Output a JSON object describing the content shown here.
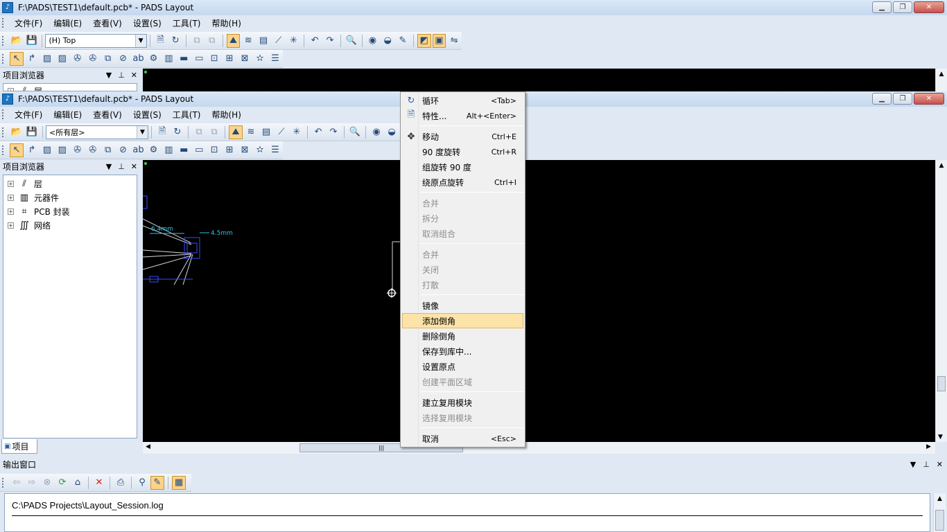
{
  "back_window": {
    "title": "F:\\PADS\\TEST1\\default.pcb* - PADS Layout",
    "layer_select": "(H) Top"
  },
  "front_window": {
    "title": "F:\\PADS\\TEST1\\default.pcb* - PADS Layout",
    "layer_select": "<所有层>"
  },
  "menus": [
    "文件(F)",
    "编辑(E)",
    "查看(V)",
    "设置(S)",
    "工具(T)",
    "帮助(H)"
  ],
  "project_browser": {
    "title": "项目浏览器",
    "tab_label": "项目",
    "back_partial_item": "层",
    "items": [
      {
        "label": "层",
        "icon": "layers-icon"
      },
      {
        "label": "元器件",
        "icon": "component-icon"
      },
      {
        "label": "PCB 封装",
        "icon": "decal-icon"
      },
      {
        "label": "网络",
        "icon": "net-icon"
      }
    ]
  },
  "dimensions": {
    "d1": "6.4mm",
    "d2": "4.5mm"
  },
  "context_menu": {
    "items": [
      {
        "label": "循环",
        "key": "<Tab>",
        "icon": "cycle-icon",
        "enabled": true
      },
      {
        "label": "特性...",
        "key": "Alt+<Enter>",
        "icon": "properties-icon",
        "enabled": true
      },
      {
        "label": "移动",
        "key": "Ctrl+E",
        "icon": "move-icon",
        "enabled": true
      },
      {
        "label": "90 度旋转",
        "key": "Ctrl+R",
        "enabled": true
      },
      {
        "label": "组旋转 90 度",
        "key": "",
        "enabled": true
      },
      {
        "label": "绕原点旋转",
        "key": "Ctrl+I",
        "enabled": true
      },
      {
        "label": "合并",
        "key": "",
        "enabled": false
      },
      {
        "label": "拆分",
        "key": "",
        "enabled": false
      },
      {
        "label": "取消组合",
        "key": "",
        "enabled": false
      },
      {
        "label": "合并",
        "key": "",
        "enabled": false
      },
      {
        "label": "关闭",
        "key": "",
        "enabled": false
      },
      {
        "label": "打散",
        "key": "",
        "enabled": false
      },
      {
        "label": "镜像",
        "key": "",
        "enabled": true
      },
      {
        "label": "添加倒角",
        "key": "",
        "enabled": true,
        "highlighted": true
      },
      {
        "label": "删除倒角",
        "key": "",
        "enabled": true
      },
      {
        "label": "保存到库中...",
        "key": "",
        "enabled": true
      },
      {
        "label": "设置原点",
        "key": "",
        "enabled": true
      },
      {
        "label": "创建平面区域",
        "key": "",
        "enabled": false
      },
      {
        "label": "建立复用模块",
        "key": "",
        "enabled": true
      },
      {
        "label": "选择复用模块",
        "key": "",
        "enabled": false
      },
      {
        "label": "取消",
        "key": "<Esc>",
        "enabled": true
      }
    ]
  },
  "output_window": {
    "title": "输出窗口",
    "log_path": "C:\\PADS Projects\\Layout_Session.log"
  },
  "colors": {
    "canvas": "#000000",
    "dimension": "#2fc4e8",
    "outline": "#3a4cff",
    "highlight": "#fce3a8"
  }
}
